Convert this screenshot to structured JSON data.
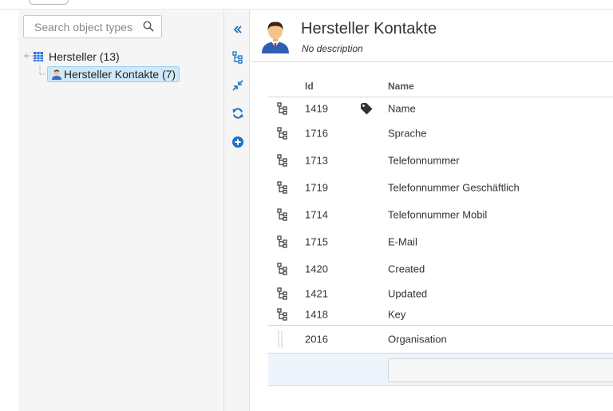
{
  "search": {
    "placeholder": "Search object types"
  },
  "tree": {
    "root": {
      "label": "Hersteller (13)"
    },
    "child": {
      "label": "Hersteller Kontakte (7)"
    }
  },
  "toolbar": {
    "collapse_icon": "double-chevron-left-icon",
    "hierarchy_icon": "hierarchy-icon",
    "shrink_icon": "shrink-arrows-icon",
    "refresh_icon": "refresh-icon",
    "add_icon": "add-circle-icon"
  },
  "header": {
    "title": "Hersteller Kontakte",
    "description": "No description"
  },
  "grid": {
    "columns": {
      "id": "Id",
      "name": "Name"
    },
    "rows": [
      {
        "id": "1419",
        "name": "Name",
        "label_tag": true
      },
      {
        "id": "1716",
        "name": "Sprache"
      },
      {
        "id": "1713",
        "name": "Telefonnummer"
      },
      {
        "id": "1719",
        "name": "Telefonnummer Geschäftlich"
      },
      {
        "id": "1714",
        "name": "Telefonnummer Mobil"
      },
      {
        "id": "1715",
        "name": "E-Mail"
      },
      {
        "id": "1420",
        "name": "Created"
      },
      {
        "id": "1421",
        "name": "Updated"
      },
      {
        "id": "1418",
        "name": "Key"
      }
    ],
    "reference_rows": [
      {
        "id": "2016",
        "name": "Organisation"
      }
    ]
  },
  "colors": {
    "accent": "#1a73c8",
    "selection": "#cfe8fa",
    "pane_bg": "#f5f5f5"
  }
}
